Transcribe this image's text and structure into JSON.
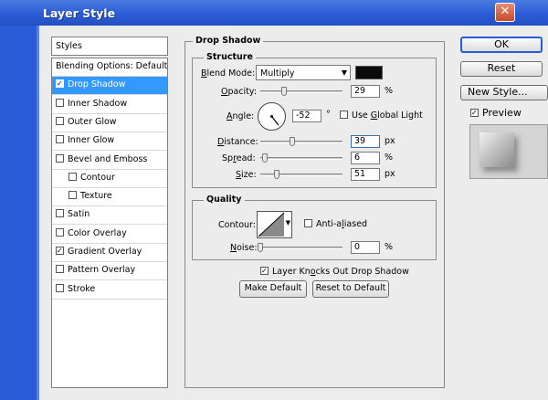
{
  "window": {
    "title": "Layer Style",
    "close_glyph": "✕"
  },
  "sidebar": {
    "header": "Styles",
    "items": [
      {
        "label": "Blending Options: Default",
        "checkbox": false,
        "checked": false
      },
      {
        "label": "Drop Shadow",
        "checkbox": true,
        "checked": true,
        "selected": true
      },
      {
        "label": "Inner Shadow",
        "checkbox": true,
        "checked": false
      },
      {
        "label": "Outer Glow",
        "checkbox": true,
        "checked": false
      },
      {
        "label": "Inner Glow",
        "checkbox": true,
        "checked": false
      },
      {
        "label": "Bevel and Emboss",
        "checkbox": true,
        "checked": false
      },
      {
        "label": "Contour",
        "checkbox": true,
        "checked": false,
        "indent": true
      },
      {
        "label": "Texture",
        "checkbox": true,
        "checked": false,
        "indent": true
      },
      {
        "label": "Satin",
        "checkbox": true,
        "checked": false
      },
      {
        "label": "Color Overlay",
        "checkbox": true,
        "checked": false
      },
      {
        "label": "Gradient Overlay",
        "checkbox": true,
        "checked": true
      },
      {
        "label": "Pattern Overlay",
        "checkbox": true,
        "checked": false
      },
      {
        "label": "Stroke",
        "checkbox": true,
        "checked": false
      }
    ]
  },
  "panel": {
    "title": "Drop Shadow",
    "structure": {
      "title": "Structure",
      "blend_mode": {
        "label_u": "B",
        "label_rest": "lend Mode:",
        "value": "Multiply",
        "color": "#0a0a0a"
      },
      "opacity": {
        "label_u": "O",
        "label_rest": "pacity:",
        "value": "29",
        "unit": "%",
        "level": 0.29
      },
      "angle": {
        "label_pre": "",
        "label_u": "A",
        "label_rest": "ngle:",
        "value": "-52",
        "unit": "°",
        "degrees": -52
      },
      "global_light": {
        "label_pre": "Use ",
        "label_u": "G",
        "label_rest": "lobal Light",
        "checked": false
      },
      "distance": {
        "label_u": "D",
        "label_rest": "istance:",
        "value": "39",
        "unit": "px",
        "level": 0.39
      },
      "spread": {
        "label_pre": "Sp",
        "label_u": "r",
        "label_rest": "ead:",
        "value": "6",
        "unit": "%",
        "level": 0.06
      },
      "size": {
        "label_u": "S",
        "label_rest": "ize:",
        "value": "51",
        "unit": "px",
        "level": 0.2
      }
    },
    "quality": {
      "title": "Quality",
      "contour": {
        "label": "Contour:"
      },
      "anti_aliased": {
        "label_pre": "Anti-a",
        "label_u": "l",
        "label_rest": "iased",
        "checked": false
      },
      "noise": {
        "label_u": "N",
        "label_rest": "oise:",
        "value": "0",
        "unit": "%",
        "level": 0.0
      }
    },
    "knocks_out": {
      "label_pre": "Layer Kn",
      "label_u": "o",
      "label_rest": "cks Out Drop Shadow",
      "checked": true
    },
    "make_default": "Make Default",
    "reset_default": "Reset to Default"
  },
  "right": {
    "ok": "OK",
    "reset": "Reset",
    "new_style": "New Style...",
    "preview": {
      "label": "Preview",
      "checked": true
    }
  },
  "colors": {
    "title_bar": "#2a5bd6",
    "selection": "#3399ff",
    "default_border": "#2a5bd6"
  }
}
